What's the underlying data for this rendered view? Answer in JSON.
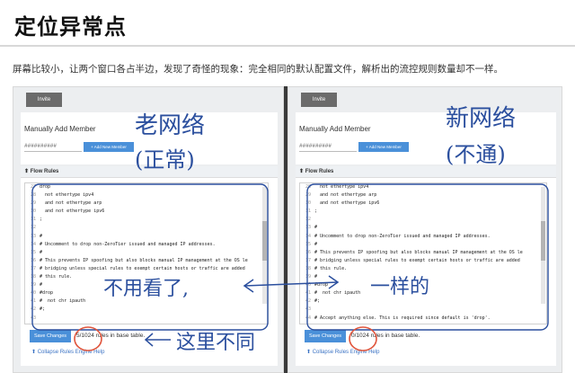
{
  "title": "定位异常点",
  "description": "屏幕比较小，让两个窗口各占半边，发现了奇怪的现象：完全相同的默认配置文件，解析出的流控规则数量却不一样。",
  "left": {
    "tab_label": "Invite",
    "manual_label": "Manually Add Member",
    "hash_text": "##########",
    "add_button": "+ Add New Member",
    "flow_title": "Flow Rules",
    "code_lines": [
      {
        "n": "27",
        "t": "drop"
      },
      {
        "n": "28",
        "t": "  not ethertype ipv4"
      },
      {
        "n": "29",
        "t": "  and not ethertype arp"
      },
      {
        "n": "30",
        "t": "  and not ethertype ipv6"
      },
      {
        "n": "31",
        "t": ";"
      },
      {
        "n": "32",
        "t": ""
      },
      {
        "n": "33",
        "t": "#"
      },
      {
        "n": "34",
        "t": "# Uncomment to drop non-ZeroTier issued and managed IP addresses."
      },
      {
        "n": "35",
        "t": "#"
      },
      {
        "n": "36",
        "t": "# This prevents IP spoofing but also blocks manual IP management at the OS le"
      },
      {
        "n": "37",
        "t": "# bridging unless special rules to exempt certain hosts or traffic are added"
      },
      {
        "n": "38",
        "t": "# this rule."
      },
      {
        "n": "39",
        "t": "#"
      },
      {
        "n": "40",
        "t": "#drop"
      },
      {
        "n": "41",
        "t": "#  not chr ipauth"
      },
      {
        "n": "42",
        "t": "#;"
      },
      {
        "n": "43",
        "t": ""
      },
      {
        "n": "44",
        "t": "# Accept anything else. This is required since default is 'drop'."
      },
      {
        "n": "45",
        "t": "accept;"
      }
    ],
    "save_button": "Save Changes",
    "rules_text": "5/1024 rules in base table.",
    "collapse_text": "Collapse Rules Engine Help"
  },
  "right": {
    "tab_label": "Invite",
    "manual_label": "Manually Add Member",
    "hash_text": "##########",
    "add_button": "+ Add New Member",
    "flow_title": "Flow Rules",
    "code_lines": [
      {
        "n": "28",
        "t": "  not ethertype ipv4"
      },
      {
        "n": "29",
        "t": "  and not ethertype arp"
      },
      {
        "n": "30",
        "t": "  and not ethertype ipv6"
      },
      {
        "n": "31",
        "t": ";"
      },
      {
        "n": "32",
        "t": ""
      },
      {
        "n": "33",
        "t": "#"
      },
      {
        "n": "34",
        "t": "# Uncomment to drop non-ZeroTier issued and managed IP addresses."
      },
      {
        "n": "35",
        "t": "#"
      },
      {
        "n": "36",
        "t": "# This prevents IP spoofing but also blocks manual IP management at the OS le"
      },
      {
        "n": "37",
        "t": "# bridging unless special rules to exempt certain hosts or traffic are added"
      },
      {
        "n": "38",
        "t": "# this rule."
      },
      {
        "n": "39",
        "t": "#"
      },
      {
        "n": "40",
        "t": "#drop"
      },
      {
        "n": "41",
        "t": "#  not chr ipauth"
      },
      {
        "n": "42",
        "t": "#;"
      },
      {
        "n": "43",
        "t": ""
      },
      {
        "n": "44",
        "t": "# Accept anything else. This is required since default is 'drop'."
      },
      {
        "n": "45",
        "t": "accept;"
      }
    ],
    "save_button": "Save Changes",
    "rules_text": "0/1024 rules in base table.",
    "collapse_text": "Collapse Rules Engine Help"
  },
  "annotations": {
    "old_network": "老网络",
    "old_status": "(正常)",
    "new_network": "新网络",
    "new_status": "(不通)",
    "no_need": "不用看了,",
    "same": "一样的",
    "here_diff": "这里不同"
  },
  "colors": {
    "ink": "#2b4f9e",
    "accent": "#4a90d9",
    "circle": "#e0553c",
    "divider": "#3a3a3a"
  },
  "icons": [
    "arrow-up-icon",
    "double-arrow-icon",
    "left-arrow-icon",
    "collapse-arrow-icon"
  ]
}
